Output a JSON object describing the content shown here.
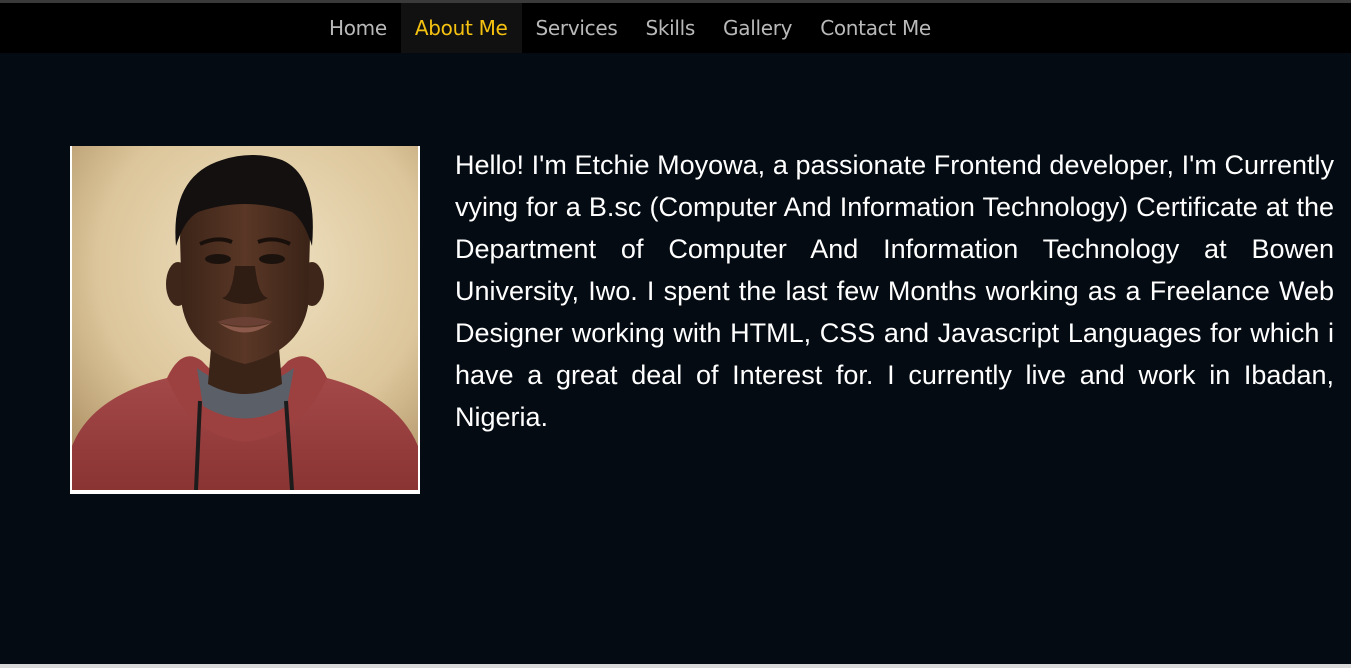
{
  "nav": {
    "items": [
      {
        "label": "Home",
        "active": false
      },
      {
        "label": "About Me",
        "active": true
      },
      {
        "label": "Services",
        "active": false
      },
      {
        "label": "Skills",
        "active": false
      },
      {
        "label": "Gallery",
        "active": false
      },
      {
        "label": "Contact Me",
        "active": false
      }
    ]
  },
  "about": {
    "photo_alt": "portrait-photo",
    "bio": "Hello! I'm Etchie Moyowa, a passionate Frontend developer, I'm Currently vying for a B.sc (Computer And Information Technology) Certificate at the Department of Computer And Information Technology at Bowen University, Iwo. I spent the last few Months working as a Freelance Web Designer working with HTML, CSS and Javascript Languages for which i have a great deal of Interest for. I currently live and work in Ibadan, Nigeria."
  },
  "colors": {
    "page_background": "#050b12",
    "nav_background": "#000000",
    "nav_text": "#b9b9b9",
    "nav_active_text": "#f5c211",
    "bio_text": "#ffffff"
  }
}
